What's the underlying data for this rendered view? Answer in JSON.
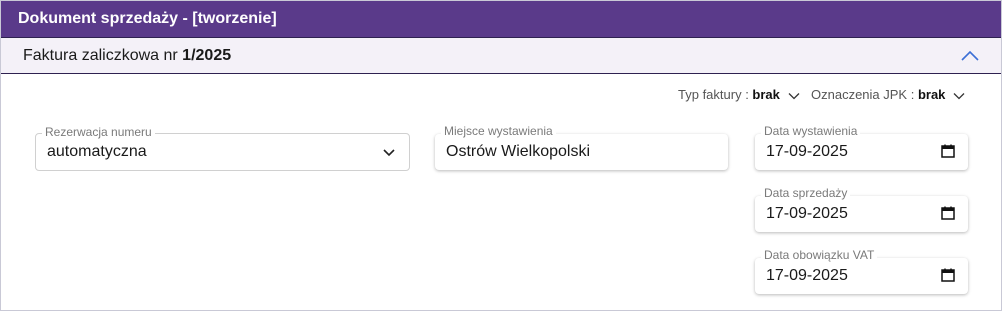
{
  "window": {
    "title": "Dokument sprzedaży - [tworzenie]"
  },
  "section": {
    "prefix": "Faktura zaliczkowa nr ",
    "number": "1/2025"
  },
  "meta": {
    "invoice_type_label": "Typ faktury : ",
    "invoice_type_value": "brak",
    "jpk_label": "Oznaczenia JPK : ",
    "jpk_value": "brak"
  },
  "fields": {
    "reservation": {
      "label": "Rezerwacja numeru",
      "value": "automatyczna"
    },
    "place": {
      "label": "Miejsce wystawienia",
      "value": "Ostrów Wielkopolski"
    },
    "issue_date": {
      "label": "Data wystawienia",
      "value": "17-09-2025"
    },
    "sale_date": {
      "label": "Data sprzedaży",
      "value": "17-09-2025"
    },
    "vat_date": {
      "label": "Data obowiązku VAT",
      "value": "17-09-2025"
    }
  },
  "colors": {
    "titlebar": "#5a3a8a",
    "accent": "#3b6fd6"
  },
  "icons": {
    "collapse": "chevron-up-icon",
    "dropdown": "chevron-down-icon",
    "calendar": "calendar-icon"
  }
}
